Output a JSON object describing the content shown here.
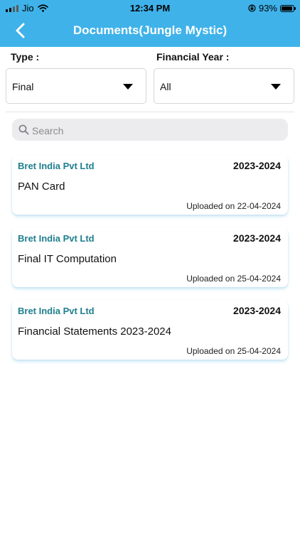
{
  "status_bar": {
    "carrier": "Jio",
    "time": "12:34 PM",
    "battery_percent": "93%",
    "battery_level": 0.93
  },
  "header": {
    "title": "Documents(Jungle Mystic)",
    "background": "#3fb2ea"
  },
  "filters": {
    "type": {
      "label": "Type :",
      "value": "Final"
    },
    "financial_year": {
      "label": "Financial Year :",
      "value": "All"
    }
  },
  "search": {
    "placeholder": "Search",
    "value": ""
  },
  "documents": [
    {
      "company": "Bret India Pvt Ltd",
      "year": "2023-2024",
      "name": "PAN Card",
      "uploaded_label": "Uploaded on",
      "uploaded_date": "22-04-2024"
    },
    {
      "company": "Bret India Pvt Ltd",
      "year": "2023-2024",
      "name": "Final IT Computation",
      "uploaded_label": "Uploaded on",
      "uploaded_date": "25-04-2024"
    },
    {
      "company": "Bret India Pvt Ltd",
      "year": "2023-2024",
      "name": "Financial Statements 2023-2024",
      "uploaded_label": "Uploaded on",
      "uploaded_date": "25-04-2024"
    }
  ],
  "colors": {
    "company_text": "#1e7f8e",
    "accent": "#3fb2ea"
  },
  "icons": {
    "back": "chevron-left-icon",
    "search": "magnifier-icon",
    "dropdown": "caret-down-icon"
  }
}
